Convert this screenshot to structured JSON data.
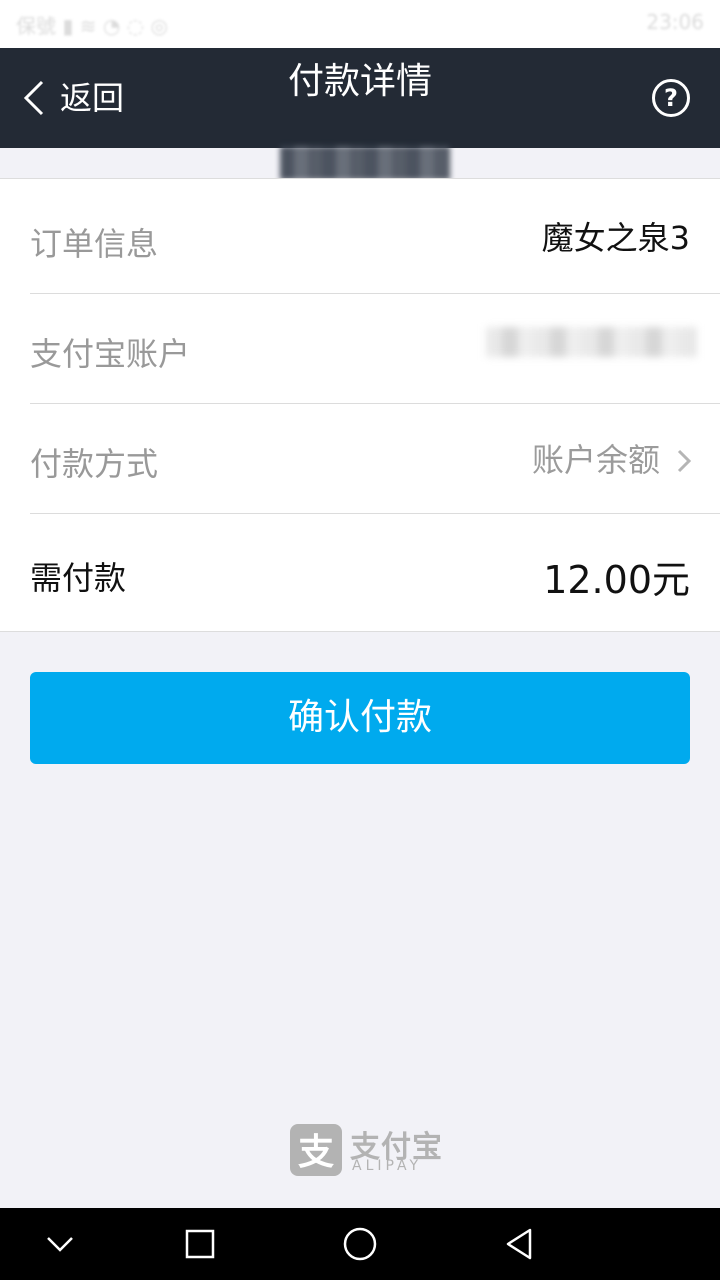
{
  "status_bar": {
    "left_text": "保號 (blurred)",
    "right_text": "23:06"
  },
  "header": {
    "back_label": "返回",
    "title": "付款详情"
  },
  "rows": [
    {
      "label": "订单信息",
      "value": "魔女之泉3"
    },
    {
      "label": "支付宝账户",
      "value": ""
    },
    {
      "label": "付款方式",
      "value": "账户余额"
    },
    {
      "label": "需付款",
      "value": "12.00元"
    }
  ],
  "confirm_label": "确认付款",
  "logo": {
    "cn": "支付宝",
    "en": "ALIPAY"
  },
  "colors": {
    "header_bg": "#232a35",
    "primary": "#00aaee",
    "page_bg": "#f2f2f7"
  },
  "icons": {
    "back": "chevron-left-icon",
    "help": "question-circle-icon",
    "disclosure": "chevron-right-icon",
    "nav_down": "chevron-down-icon",
    "nav_recent": "square-icon",
    "nav_home": "circle-icon",
    "nav_back": "triangle-back-icon"
  }
}
